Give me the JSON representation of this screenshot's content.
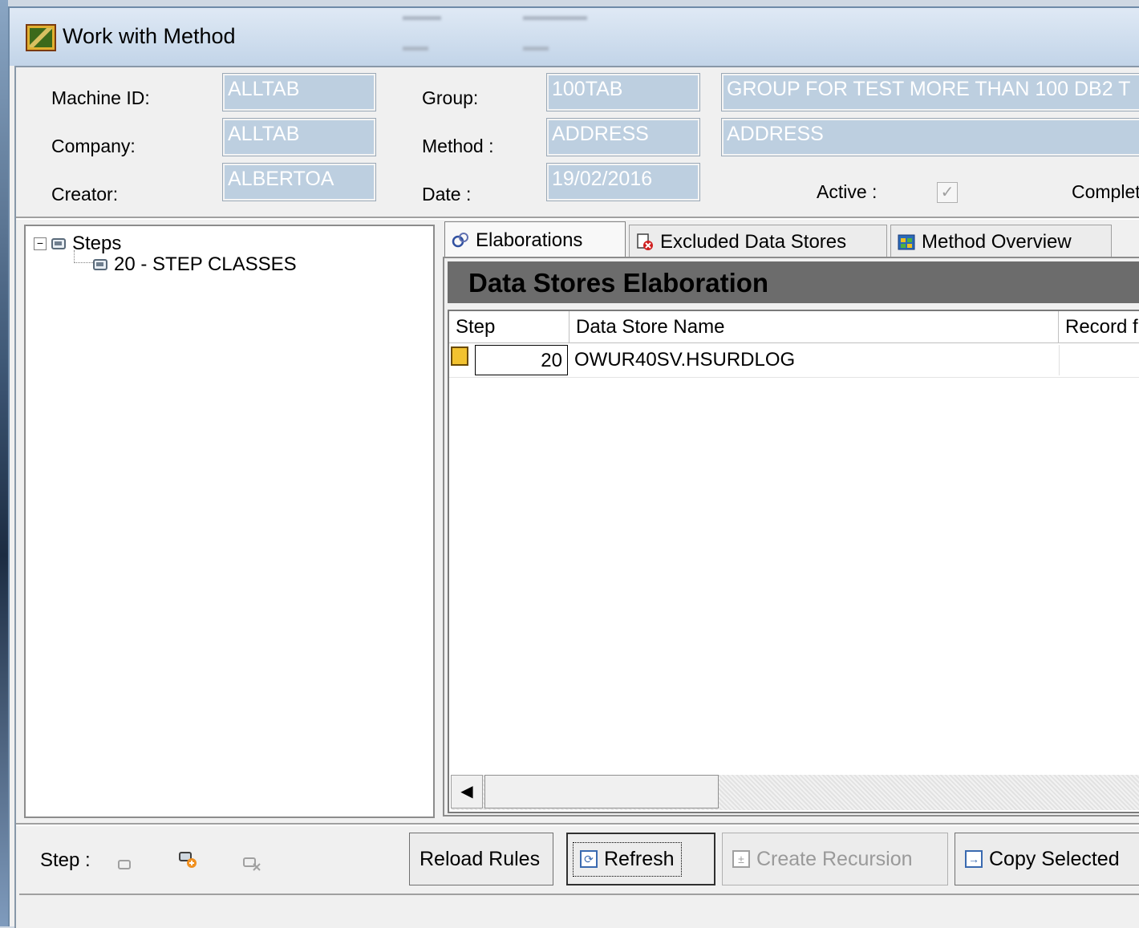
{
  "window": {
    "title": "Work with Method"
  },
  "header": {
    "machine_id_label": "Machine ID:",
    "machine_id_value": "ALLTAB",
    "company_label": "Company:",
    "company_value": "ALLTAB",
    "creator_label": "Creator:",
    "creator_value": "ALBERTOA",
    "group_label": "Group:",
    "group_value": "100TAB",
    "group_description": "GROUP FOR TEST MORE THAN 100 DB2 T",
    "method_label": "Method :",
    "method_value": "ADDRESS",
    "method_description": "ADDRESS",
    "date_label": "Date :",
    "date_value": "19/02/2016",
    "active_label": "Active :",
    "active_checked": true,
    "complete_label": "Complet"
  },
  "tree": {
    "root_label": "Steps",
    "root_expander": "⊟",
    "children": [
      "20 - STEP CLASSES"
    ]
  },
  "tabs": [
    {
      "label": "Elaborations",
      "icon": "gears-icon"
    },
    {
      "label": "Excluded Data Stores",
      "icon": "excluded-icon"
    },
    {
      "label": "Method Overview",
      "icon": "overview-icon"
    }
  ],
  "panel": {
    "banner": "Data Stores Elaboration"
  },
  "grid": {
    "columns": [
      "Step",
      "Data Store Name",
      "Record f"
    ],
    "rows": [
      {
        "step": "20",
        "data_store_name": "OWUR40SV.HSURDLOG",
        "record": ""
      }
    ],
    "scroll_left_arrow": "◀"
  },
  "toolbar": {
    "step_label": "Step :",
    "reload_rules": "Reload Rules",
    "refresh": "Refresh",
    "create_recursion": "Create Recursion",
    "copy_selected": "Copy Selected"
  },
  "colors": {
    "field_background": "#bdcfe0",
    "banner_background": "#6c6c6c",
    "title_gradient_top": "#dfe9f5"
  }
}
